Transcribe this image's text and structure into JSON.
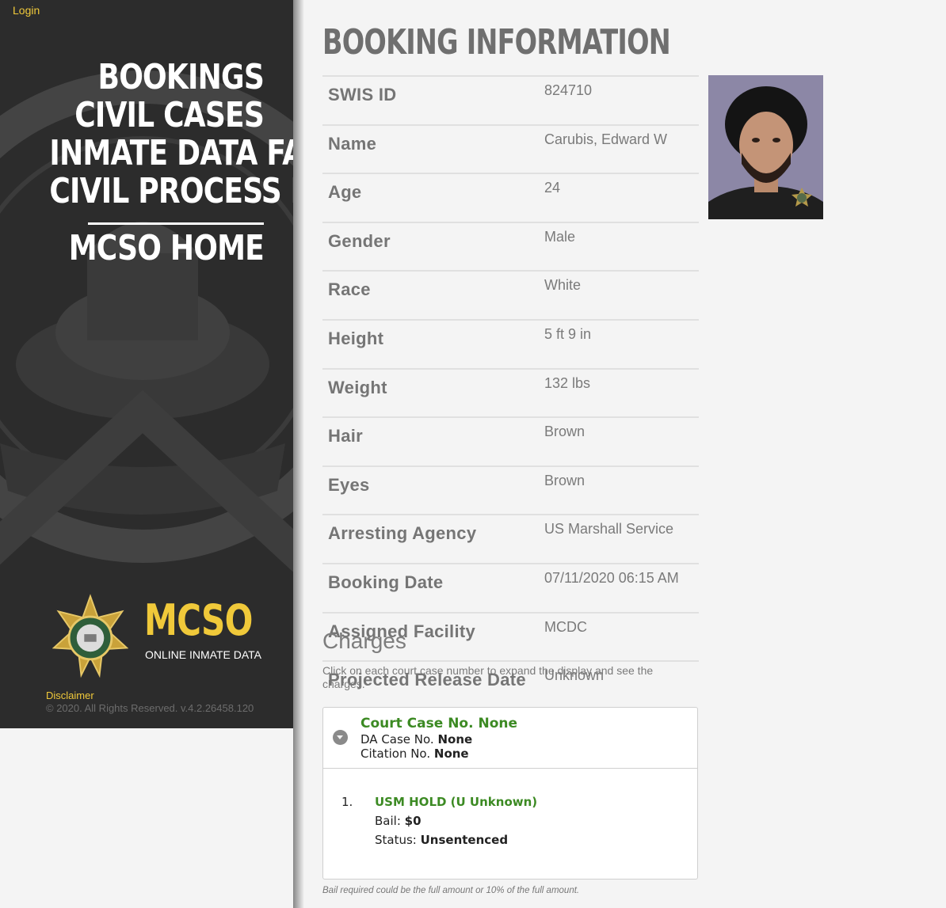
{
  "sidebar": {
    "login": "Login",
    "nav": [
      "BOOKINGS",
      "CIVIL CASES",
      "INMATE DATA FAQ",
      "CIVIL PROCESS FAQ"
    ],
    "home": "MCSO HOME",
    "brand": {
      "title": "MCSO",
      "subtitle": "ONLINE INMATE DATA",
      "badge_icon": "sheriff-star-badge-icon"
    },
    "disclaimer": "Disclaimer",
    "copyright": "© 2020. All Rights Reserved.   v.4.2.26458.120"
  },
  "page": {
    "title": "BOOKING INFORMATION",
    "fields": [
      {
        "label": "SWIS ID",
        "value": "824710"
      },
      {
        "label": "Name",
        "value": "Carubis, Edward W"
      },
      {
        "label": "Age",
        "value": "24"
      },
      {
        "label": "Gender",
        "value": "Male"
      },
      {
        "label": "Race",
        "value": "White"
      },
      {
        "label": "Height",
        "value": "5 ft 9 in"
      },
      {
        "label": "Weight",
        "value": "132 lbs"
      },
      {
        "label": "Hair",
        "value": "Brown"
      },
      {
        "label": "Eyes",
        "value": "Brown"
      },
      {
        "label": "Arresting Agency",
        "value": "US Marshall Service"
      },
      {
        "label": "Booking Date",
        "value": "07/11/2020 06:15 AM"
      },
      {
        "label": "Assigned Facility",
        "value": "MCDC"
      },
      {
        "label": "Projected Release Date",
        "value": "Unknown"
      }
    ]
  },
  "charges": {
    "title": "Charges",
    "instruction": "Click on each court case number to expand the display and see the charges.",
    "case": {
      "court_case": "Court Case No. None",
      "da_label": "DA Case No. ",
      "da_value": "None",
      "citation_label": "Citation No. ",
      "citation_value": "None"
    },
    "items": [
      {
        "num": "1.",
        "name": "USM HOLD (U Unknown)",
        "bail_label": "Bail: ",
        "bail": "$0",
        "status_label": "Status: ",
        "status": "Unsentenced"
      }
    ],
    "bail_note": "Bail required could be the full amount or 10% of the full amount."
  },
  "colors": {
    "accent_gold": "#f0c93a",
    "charge_green": "#3c8a23",
    "sidebar_bg": "#2c2c2c"
  }
}
